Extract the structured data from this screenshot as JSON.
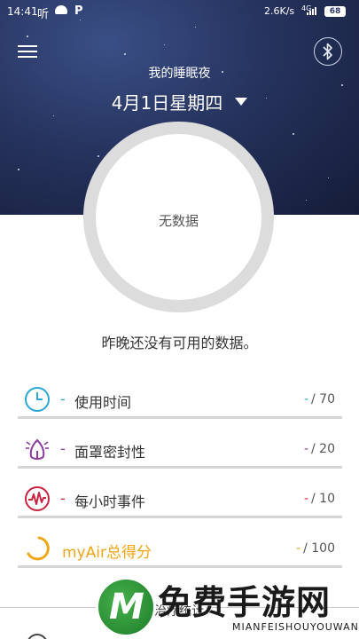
{
  "status": {
    "time": "14:41",
    "app": "听",
    "p_icon": "P",
    "speed": "2.6K/s",
    "network": "4G",
    "battery": "68"
  },
  "header": {
    "subtitle": "我的睡眠夜",
    "date": "4月1日星期四",
    "menu_icon": "hamburger-menu-icon",
    "bluetooth_icon": "bluetooth-icon"
  },
  "ring": {
    "label": "无数据"
  },
  "message": "昨晚还没有可用的数据。",
  "metrics": [
    {
      "label": "使用时间",
      "dash": "-",
      "score_dash": "-",
      "score_max": "/ 70",
      "icon": "clock-icon",
      "color": "#2aa7d6"
    },
    {
      "label": "面罩密封性",
      "dash": "-",
      "score_dash": "-",
      "score_max": "/ 20",
      "icon": "mask-icon",
      "color": "#8b3a9e"
    },
    {
      "label": "每小时事件",
      "dash": "-",
      "score_dash": "-",
      "score_max": "/ 10",
      "icon": "events-wave-icon",
      "color": "#c8243f"
    },
    {
      "label": "myAir总得分",
      "dash": "",
      "score_dash": "-",
      "score_max": "/ 100",
      "icon": "total-score-ring-icon",
      "color": "#f0a516"
    }
  ],
  "footer": {
    "section_title": "治疗统计"
  },
  "watermark": {
    "title": "免费手游网",
    "subtitle": "MIANFEISHOUYOUWANG",
    "logo": "M"
  }
}
